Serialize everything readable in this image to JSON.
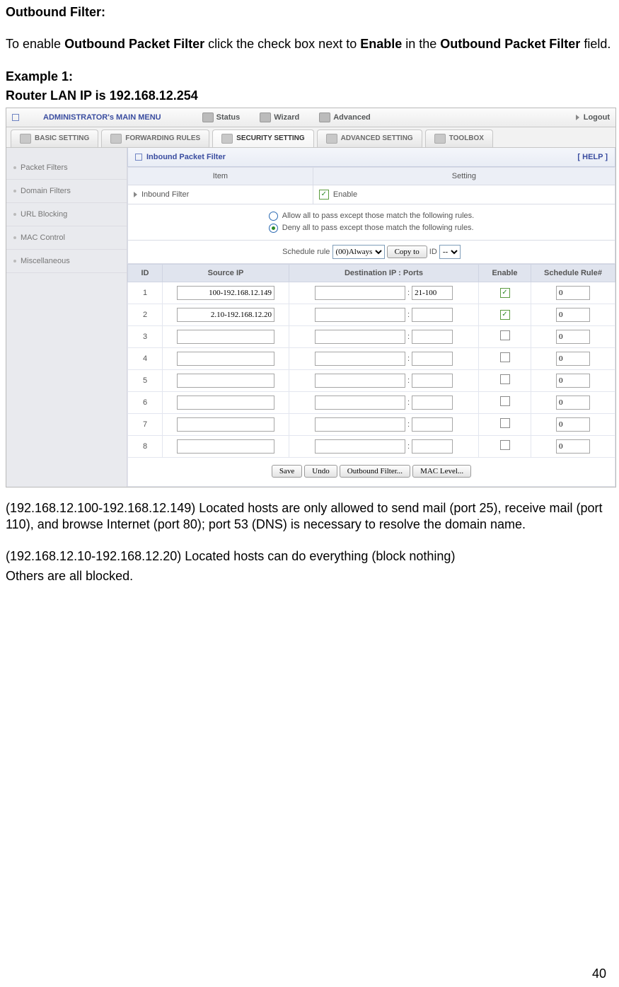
{
  "doc": {
    "heading": "Outbound Filter:",
    "intro_prefix": "To enable ",
    "intro_b1": "Outbound Packet Filter",
    "intro_mid1": " click the check box next to ",
    "intro_b2": "Enable",
    "intro_mid2": " in the ",
    "intro_b3": "Outbound Packet Filter",
    "intro_suffix": " field.",
    "example_label": "Example 1:",
    "router_ip_line": "Router LAN IP is 192.168.12.254",
    "para1": "(192.168.12.100-192.168.12.149) Located hosts are only allowed to send mail (port 25), receive mail (port 110), and browse Internet (port 80); port 53 (DNS) is necessary to resolve the domain name.",
    "para2a": "(192.168.12.10-192.168.12.20) Located hosts can do everything (block nothing)",
    "para2b": "Others are all blocked.",
    "page_number": "40"
  },
  "router": {
    "top": {
      "title": "ADMINISTRATOR's MAIN MENU",
      "status": "Status",
      "wizard": "Wizard",
      "advanced": "Advanced",
      "logout": "Logout"
    },
    "tabs": {
      "basic": "BASIC SETTING",
      "forwarding": "FORWARDING RULES",
      "security": "SECURITY SETTING",
      "advanced": "ADVANCED SETTING",
      "toolbox": "TOOLBOX"
    },
    "sidebar": [
      "Packet Filters",
      "Domain Filters",
      "URL Blocking",
      "MAC Control",
      "Miscellaneous"
    ],
    "panel": {
      "title": "Inbound Packet Filter",
      "help": "[ HELP ]",
      "col_item": "Item",
      "col_setting": "Setting",
      "row_label": "Inbound Filter",
      "row_value": "Enable",
      "rule_allow": "Allow all to pass except those match the following rules.",
      "rule_deny": "Deny all to pass except those match the following rules.",
      "sched_label": "Schedule rule",
      "sched_option": "(00)Always",
      "copy_btn": "Copy to",
      "id_label": "ID",
      "id_option": "--"
    },
    "rules_header": {
      "id": "ID",
      "src": "Source IP",
      "dst": "Destination IP : Ports",
      "enable": "Enable",
      "sched": "Schedule Rule#"
    },
    "rules": [
      {
        "id": "1",
        "src": "100-192.168.12.149",
        "dip": "",
        "dport": "21-100",
        "enabled": true,
        "sr": "0"
      },
      {
        "id": "2",
        "src": "2.10-192.168.12.20",
        "dip": "",
        "dport": "",
        "enabled": true,
        "sr": "0"
      },
      {
        "id": "3",
        "src": "",
        "dip": "",
        "dport": "",
        "enabled": false,
        "sr": "0"
      },
      {
        "id": "4",
        "src": "",
        "dip": "",
        "dport": "",
        "enabled": false,
        "sr": "0"
      },
      {
        "id": "5",
        "src": "",
        "dip": "",
        "dport": "",
        "enabled": false,
        "sr": "0"
      },
      {
        "id": "6",
        "src": "",
        "dip": "",
        "dport": "",
        "enabled": false,
        "sr": "0"
      },
      {
        "id": "7",
        "src": "",
        "dip": "",
        "dport": "",
        "enabled": false,
        "sr": "0"
      },
      {
        "id": "8",
        "src": "",
        "dip": "",
        "dport": "",
        "enabled": false,
        "sr": "0"
      }
    ],
    "buttons": {
      "save": "Save",
      "undo": "Undo",
      "outbound": "Outbound Filter...",
      "mac": "MAC Level..."
    }
  }
}
